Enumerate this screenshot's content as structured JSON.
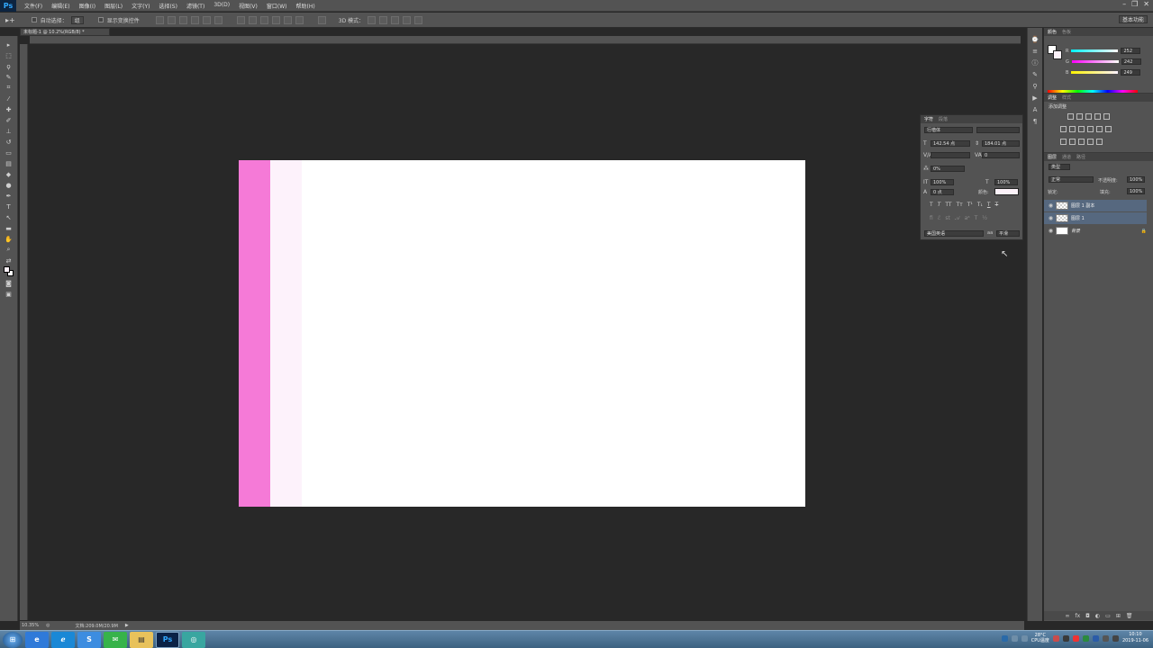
{
  "app": {
    "logo": "Ps"
  },
  "menu": {
    "items": [
      "文件(F)",
      "编辑(E)",
      "图像(I)",
      "图层(L)",
      "文字(Y)",
      "选择(S)",
      "滤镜(T)",
      "3D(D)",
      "视图(V)",
      "窗口(W)",
      "帮助(H)"
    ]
  },
  "window_controls": {
    "minimize": "–",
    "restore": "❐",
    "close": "✕"
  },
  "options": {
    "auto_select_label": "自动选择：",
    "auto_select_value": "组",
    "show_transform_label": "显示变换控件",
    "mode_3d_label": "3D 模式：",
    "workspace_value": "基本功能"
  },
  "document": {
    "tab_title": "未标题-1 @ 10.2%(RGB/8) *",
    "zoom": "10.35%",
    "doc_info": "文档:209.0M/20.9M",
    "colors": {
      "stripe_pink": "#f57ad7",
      "stripe_light": "#fdf2fb",
      "background": "#ffffff"
    }
  },
  "color_panel": {
    "tabs": [
      "颜色",
      "色板"
    ],
    "r_label": "R",
    "g_label": "G",
    "b_label": "B",
    "r": "252",
    "g": "242",
    "b": "249"
  },
  "adjustments_panel": {
    "tabs": [
      "调整",
      "样式"
    ],
    "title": "添加调整"
  },
  "character_panel": {
    "tabs": [
      "字符",
      "段落"
    ],
    "font_family": "行楷体",
    "font_size": "142.54 点",
    "leading": "184.01 点",
    "kerning": "",
    "tracking": "0",
    "scale_label": "0%",
    "vscale": "100%",
    "hscale": "100%",
    "baseline": "0 点",
    "color_label": "颜色:",
    "language": "美国英语",
    "aa_label": "aa",
    "antialias": "平滑"
  },
  "layers_panel": {
    "tabs": [
      "图层",
      "通道",
      "路径"
    ],
    "filter_kind": "类型",
    "blend_mode": "正常",
    "opacity_label": "不透明度:",
    "opacity": "100%",
    "lock_label": "锁定:",
    "fill_label": "填充:",
    "fill": "100%",
    "layers": [
      {
        "name": "图层 1 副本",
        "selected": true
      },
      {
        "name": "图层 1",
        "selected": true
      },
      {
        "name": "背景",
        "selected": false,
        "locked": true
      }
    ]
  },
  "taskbar": {
    "tray_temp": "28°C",
    "tray_cpu": "CPU温度",
    "time": "10:10",
    "date": "2019-11-06"
  }
}
